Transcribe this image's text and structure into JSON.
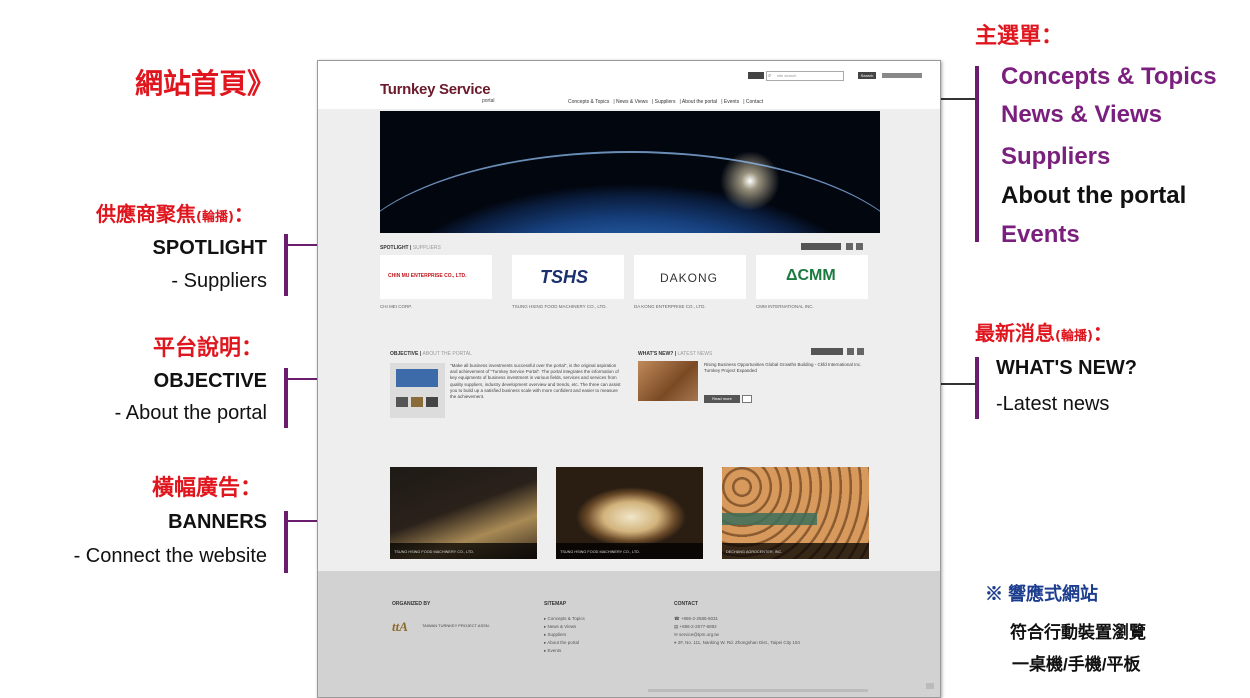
{
  "annotations": {
    "homepage_title": "網站首頁》",
    "main_menu": {
      "title": "主選單：",
      "items": [
        "Concepts & Topics",
        "News & Views",
        "Suppliers",
        "About the portal",
        "Events"
      ]
    },
    "spotlight": {
      "title": "供應商聚焦",
      "note": "(輪播)",
      "colon": "：",
      "label": "SPOTLIGHT",
      "desc": "- Suppliers"
    },
    "objective": {
      "title": "平台說明：",
      "label": "OBJECTIVE",
      "desc": "- About the portal"
    },
    "banners": {
      "title": "橫幅廣告：",
      "label": "BANNERS",
      "desc": "- Connect the website"
    },
    "whats_new": {
      "title": "最新消息",
      "note": "(輪播)",
      "colon": "：",
      "label": "WHAT'S NEW?",
      "desc": "-Latest news"
    },
    "responsive": {
      "line1": "※ 響應式網站",
      "line2": "符合行動裝置瀏覽",
      "line3": "一桌機/手機/平板"
    }
  },
  "site": {
    "logo": "Turnkey Service",
    "logo_sub": "portal",
    "nav": [
      "Concepts & Topics",
      "News & Views",
      "Suppliers",
      "About the portal",
      "Events",
      "Contact"
    ],
    "search_placeholder": "site search",
    "search_button": "Search",
    "spotlight_title": "SPOTLIGHT",
    "spotlight_sub": "SUPPLIERS",
    "suppliers": [
      {
        "logo": "CHIN MU ENTERPRISE CO., LTD.",
        "name": "CHI MEI CORP."
      },
      {
        "logo": "TSHS",
        "name": "TSUNG HSING FOOD MACHINERY CO., LTD."
      },
      {
        "logo": "DAKONG",
        "name": "DA KONG ENTERPRISE CO., LTD."
      },
      {
        "logo": "ΔCMM",
        "name": "CMM INTERNATIONAL INC."
      }
    ],
    "objective_title": "OBJECTIVE",
    "objective_sub": "ABOUT THE PORTAL",
    "objective_text": "\"Make all business investments successful over the portal\", is the original aspiration and achievement of \"Turnkey Service Portal\". The portal integrates the information of key equipments of business investment in various fields, services and services from quality suppliers, industry development overview and trends, etc. The three can assist you to build up a satisfied business scale with more confident and easier to measure the achievement.",
    "news_title": "WHAT'S NEW?",
    "news_sub": "LATEST NEWS",
    "news_text": "Rising Business Opportunities Global Growths Building - Ckfd International Inc. Turnkey Project Expanded",
    "news_button": "Read more",
    "banners": [
      {
        "caption": "TSUNG HSING FOOD MACHINERY CO., LTD."
      },
      {
        "caption": "TSUNG HSING FOOD MACHINERY CO., LTD."
      },
      {
        "caption": "DECHANG AGROCENTER, INC."
      }
    ],
    "footer": {
      "organized_by": "ORGANIZED BY",
      "org_name": "TAIWAN TURNKEY PROJECT ASSN.",
      "sitemap": "SITEMAP",
      "sitemap_items": [
        "Concepts & Topics",
        "News & Views",
        "Suppliers",
        "About the portal",
        "Events"
      ],
      "contact": "CONTACT",
      "contact_items": [
        "+886-2-2585-5031",
        "+886-2-2577-6892",
        "service@tpm.org.tw",
        "2F, No. 111, Nanking W. Rd. Zhongshan Dist., Taipei City 104"
      ]
    }
  },
  "colors": {
    "annotation_red": "#e0161f",
    "menu_purple": "#7a1f7d",
    "bar_purple": "#6b1d6d"
  }
}
